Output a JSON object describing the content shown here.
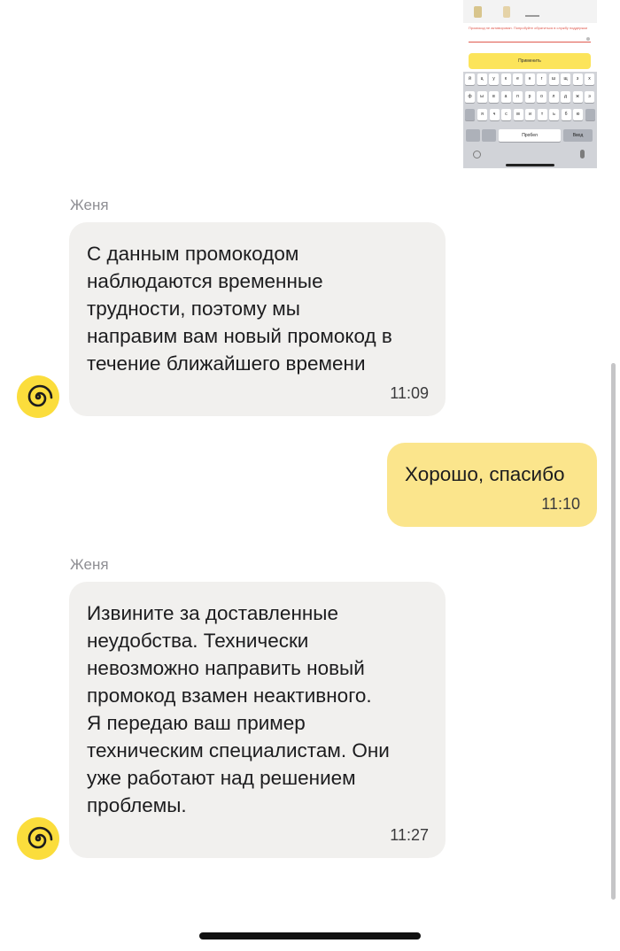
{
  "attachment": {
    "error_text": "Промокод не активирован. Попробуйте обратиться в службу поддержки",
    "apply_button_label": "Применить",
    "keyboard": {
      "row1": [
        "й",
        "ц",
        "у",
        "к",
        "е",
        "н",
        "г",
        "ш",
        "щ",
        "з",
        "х"
      ],
      "row2": [
        "ф",
        "ы",
        "в",
        "а",
        "п",
        "р",
        "о",
        "л",
        "д",
        "ж",
        "э"
      ],
      "row3": [
        "я",
        "ч",
        "с",
        "м",
        "и",
        "т",
        "ь",
        "б",
        "ю"
      ],
      "space_label": "Пробел",
      "enter_label": "Ввод"
    }
  },
  "messages": [
    {
      "sender": "Женя",
      "text": "С данным промокодом\nнаблюдаются временные\nтрудности, поэтому мы\nнаправим вам новый промокод в\nтечение ближайшего времени",
      "time": "11:09"
    },
    {
      "text": "Хорошо, спасибо",
      "time": "11:10"
    },
    {
      "sender": "Женя",
      "text": "Извините за доставленные\nнеудобства. Технически\nневозможно направить новый\nпромокод взамен неактивного.\nЯ передаю ваш пример\nтехническим специалистам. Они\nуже работают над решением\nпроблемы.",
      "time": "11:27"
    }
  ],
  "colors": {
    "incoming_bubble": "#f1f0ee",
    "outgoing_bubble": "#fbe58c",
    "avatar": "#fbdd3c"
  },
  "icons": {
    "avatar": "spiral-logo-icon",
    "attachment_globe": "globe-icon",
    "attachment_mic": "microphone-icon"
  }
}
